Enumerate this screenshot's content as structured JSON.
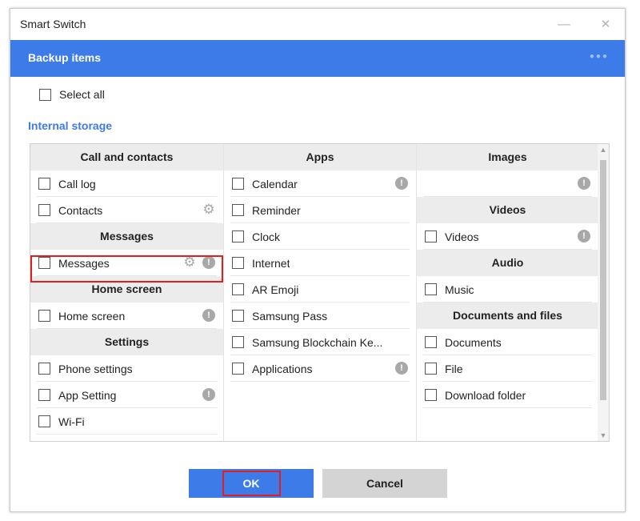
{
  "window": {
    "title": "Smart Switch",
    "minimize": "—",
    "close": "✕"
  },
  "header": {
    "title": "Backup items",
    "dots": "●●●"
  },
  "select_all": "Select all",
  "storage_label": "Internal storage",
  "columns": {
    "col1": {
      "sections": [
        {
          "title": "Call and contacts",
          "items": [
            "Call log",
            "Contacts"
          ]
        },
        {
          "title": "Messages",
          "items": [
            "Messages"
          ]
        },
        {
          "title": "Home screen",
          "items": [
            "Home screen"
          ]
        },
        {
          "title": "Settings",
          "items": [
            "Phone settings",
            "App Setting",
            "Wi-Fi"
          ]
        }
      ]
    },
    "col2": {
      "sections": [
        {
          "title": "Apps",
          "items": [
            "Calendar",
            "Reminder",
            "Clock",
            "Internet",
            "AR Emoji",
            "Samsung Pass",
            "Samsung Blockchain Ke...",
            "Applications"
          ]
        }
      ]
    },
    "col3": {
      "sections": [
        {
          "title": "Images",
          "items": [
            ""
          ]
        },
        {
          "title": "Videos",
          "items": [
            "Videos"
          ]
        },
        {
          "title": "Audio",
          "items": [
            "Music"
          ]
        },
        {
          "title": "Documents and files",
          "items": [
            "Documents",
            "File",
            "Download folder"
          ]
        }
      ]
    }
  },
  "icons": {
    "info": "!",
    "gear": "⚙"
  },
  "buttons": {
    "ok": "OK",
    "cancel": "Cancel"
  },
  "colors": {
    "accent": "#3d7be8",
    "highlight": "#e02020"
  }
}
